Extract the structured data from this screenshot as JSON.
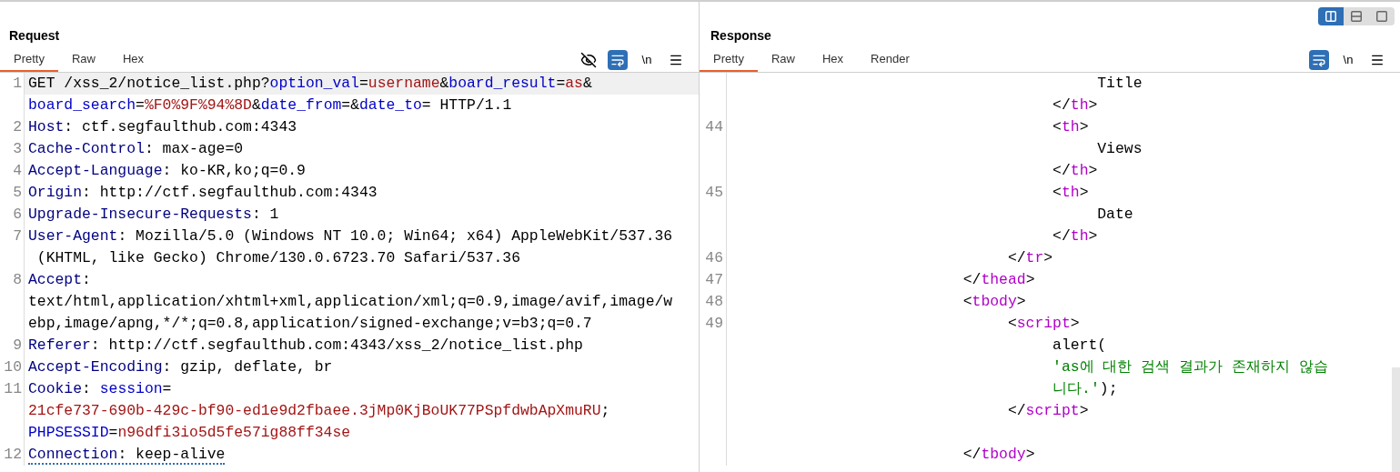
{
  "layout_options": [
    {
      "kind": "columns",
      "selected": true
    },
    {
      "kind": "rows",
      "selected": false
    },
    {
      "kind": "single",
      "selected": false
    }
  ],
  "request": {
    "title": "Request",
    "tabs": [
      {
        "label": "Pretty",
        "selected": true
      },
      {
        "label": "Raw",
        "selected": false
      },
      {
        "label": "Hex",
        "selected": false
      }
    ],
    "toolbar": {
      "wrap_on": true,
      "newline_label": "\\n"
    },
    "lines": [
      {
        "number": "1",
        "highlighted": true,
        "underlined": false,
        "rows": [
          {
            "segments": [
              {
                "kind": "text",
                "text": "GET /xss_2/notice_list.php?"
              },
              {
                "kind": "param",
                "text": "option_val"
              },
              {
                "kind": "text",
                "text": "="
              },
              {
                "kind": "value",
                "text": "username"
              },
              {
                "kind": "text",
                "text": "&"
              },
              {
                "kind": "param",
                "text": "board_result"
              },
              {
                "kind": "text",
                "text": "="
              },
              {
                "kind": "value",
                "text": "as"
              },
              {
                "kind": "text",
                "text": "&"
              }
            ]
          },
          {
            "segments": [
              {
                "kind": "param",
                "text": "board_search"
              },
              {
                "kind": "text",
                "text": "="
              },
              {
                "kind": "value",
                "text": "%F0%9F%94%8D"
              },
              {
                "kind": "text",
                "text": "&"
              },
              {
                "kind": "param",
                "text": "date_from"
              },
              {
                "kind": "text",
                "text": "=&"
              },
              {
                "kind": "param",
                "text": "date_to"
              },
              {
                "kind": "text",
                "text": "= HTTP/1.1"
              }
            ]
          }
        ]
      },
      {
        "number": "2",
        "highlighted": false,
        "underlined": false,
        "rows": [
          {
            "segments": [
              {
                "kind": "key",
                "text": "Host"
              },
              {
                "kind": "text",
                "text": ": ctf.segfaulthub.com:4343"
              }
            ]
          }
        ]
      },
      {
        "number": "3",
        "highlighted": false,
        "underlined": false,
        "rows": [
          {
            "segments": [
              {
                "kind": "key",
                "text": "Cache-Control"
              },
              {
                "kind": "text",
                "text": ": max-age=0"
              }
            ]
          }
        ]
      },
      {
        "number": "4",
        "highlighted": false,
        "underlined": false,
        "rows": [
          {
            "segments": [
              {
                "kind": "key",
                "text": "Accept-Language"
              },
              {
                "kind": "text",
                "text": ": ko-KR,ko;q=0.9"
              }
            ]
          }
        ]
      },
      {
        "number": "5",
        "highlighted": false,
        "underlined": false,
        "rows": [
          {
            "segments": [
              {
                "kind": "key",
                "text": "Origin"
              },
              {
                "kind": "text",
                "text": ": http://ctf.segfaulthub.com:4343"
              }
            ]
          }
        ]
      },
      {
        "number": "6",
        "highlighted": false,
        "underlined": false,
        "rows": [
          {
            "segments": [
              {
                "kind": "key",
                "text": "Upgrade-Insecure-Requests"
              },
              {
                "kind": "text",
                "text": ": 1"
              }
            ]
          }
        ]
      },
      {
        "number": "7",
        "highlighted": false,
        "underlined": false,
        "rows": [
          {
            "segments": [
              {
                "kind": "key",
                "text": "User-Agent"
              },
              {
                "kind": "text",
                "text": ": Mozilla/5.0 (Windows NT 10.0; Win64; x64) AppleWebKit/537.36"
              }
            ]
          },
          {
            "segments": [
              {
                "kind": "text",
                "text": " (KHTML, like Gecko) Chrome/130.0.6723.70 Safari/537.36"
              }
            ]
          }
        ]
      },
      {
        "number": "8",
        "highlighted": false,
        "underlined": false,
        "rows": [
          {
            "segments": [
              {
                "kind": "key",
                "text": "Accept"
              },
              {
                "kind": "text",
                "text": ":"
              }
            ]
          },
          {
            "segments": [
              {
                "kind": "text",
                "text": "text/html,application/xhtml+xml,application/xml;q=0.9,image/avif,image/w"
              }
            ]
          },
          {
            "segments": [
              {
                "kind": "text",
                "text": "ebp,image/apng,*/*;q=0.8,application/signed-exchange;v=b3;q=0.7"
              }
            ]
          }
        ]
      },
      {
        "number": "9",
        "highlighted": false,
        "underlined": false,
        "rows": [
          {
            "segments": [
              {
                "kind": "key",
                "text": "Referer"
              },
              {
                "kind": "text",
                "text": ": http://ctf.segfaulthub.com:4343/xss_2/notice_list.php"
              }
            ]
          }
        ]
      },
      {
        "number": "10",
        "highlighted": false,
        "underlined": false,
        "rows": [
          {
            "segments": [
              {
                "kind": "key",
                "text": "Accept-Encoding"
              },
              {
                "kind": "text",
                "text": ": gzip, deflate, br"
              }
            ]
          }
        ]
      },
      {
        "number": "11",
        "highlighted": false,
        "underlined": false,
        "rows": [
          {
            "segments": [
              {
                "kind": "key",
                "text": "Cookie"
              },
              {
                "kind": "text",
                "text": ": "
              },
              {
                "kind": "param",
                "text": "session"
              },
              {
                "kind": "text",
                "text": "="
              }
            ]
          },
          {
            "segments": [
              {
                "kind": "value",
                "text": "21cfe737-690b-429c-bf90-ed1e9d2fbaee.3jMp0KjBoUK77PSpfdwbApXmuRU"
              },
              {
                "kind": "text",
                "text": ";"
              }
            ]
          },
          {
            "segments": [
              {
                "kind": "param",
                "text": "PHPSESSID"
              },
              {
                "kind": "text",
                "text": "="
              },
              {
                "kind": "value",
                "text": "n96dfi3io5d5fe57ig88ff34se"
              }
            ]
          }
        ]
      },
      {
        "number": "12",
        "highlighted": false,
        "underlined": true,
        "rows": [
          {
            "segments": [
              {
                "kind": "key",
                "text": "Connection"
              },
              {
                "kind": "text",
                "text": ": keep-alive"
              }
            ]
          }
        ]
      }
    ]
  },
  "response": {
    "title": "Response",
    "tabs": [
      {
        "label": "Pretty",
        "selected": true
      },
      {
        "label": "Raw",
        "selected": false
      },
      {
        "label": "Hex",
        "selected": false
      },
      {
        "label": "Render",
        "selected": false
      }
    ],
    "toolbar": {
      "wrap_on": true,
      "newline_label": "\\n"
    },
    "lines": [
      {
        "rows": [
          {
            "indent": "                                         ",
            "segments": [
              {
                "kind": "text",
                "text": "Title"
              }
            ]
          },
          {
            "indent": "                                    ",
            "segments": [
              {
                "kind": "punct",
                "text": "</"
              },
              {
                "kind": "tag",
                "text": "th"
              },
              {
                "kind": "punct",
                "text": ">"
              }
            ]
          }
        ]
      },
      {
        "number": "44",
        "rows": [
          {
            "indent": "                                    ",
            "segments": [
              {
                "kind": "punct",
                "text": "<"
              },
              {
                "kind": "tag",
                "text": "th"
              },
              {
                "kind": "punct",
                "text": ">"
              }
            ]
          },
          {
            "indent": "                                         ",
            "segments": [
              {
                "kind": "text",
                "text": "Views"
              }
            ]
          },
          {
            "indent": "                                    ",
            "segments": [
              {
                "kind": "punct",
                "text": "</"
              },
              {
                "kind": "tag",
                "text": "th"
              },
              {
                "kind": "punct",
                "text": ">"
              }
            ]
          }
        ]
      },
      {
        "number": "45",
        "rows": [
          {
            "indent": "                                    ",
            "segments": [
              {
                "kind": "punct",
                "text": "<"
              },
              {
                "kind": "tag",
                "text": "th"
              },
              {
                "kind": "punct",
                "text": ">"
              }
            ]
          },
          {
            "indent": "                                         ",
            "segments": [
              {
                "kind": "text",
                "text": "Date"
              }
            ]
          },
          {
            "indent": "                                    ",
            "segments": [
              {
                "kind": "punct",
                "text": "</"
              },
              {
                "kind": "tag",
                "text": "th"
              },
              {
                "kind": "punct",
                "text": ">"
              }
            ]
          }
        ]
      },
      {
        "number": "46",
        "rows": [
          {
            "indent": "                               ",
            "segments": [
              {
                "kind": "punct",
                "text": "</"
              },
              {
                "kind": "tag",
                "text": "tr"
              },
              {
                "kind": "punct",
                "text": ">"
              }
            ]
          }
        ]
      },
      {
        "number": "47",
        "rows": [
          {
            "indent": "                          ",
            "segments": [
              {
                "kind": "punct",
                "text": "</"
              },
              {
                "kind": "tag",
                "text": "thead"
              },
              {
                "kind": "punct",
                "text": ">"
              }
            ]
          }
        ]
      },
      {
        "number": "48",
        "rows": [
          {
            "indent": "                          ",
            "segments": [
              {
                "kind": "punct",
                "text": "<"
              },
              {
                "kind": "tag",
                "text": "tbody"
              },
              {
                "kind": "punct",
                "text": ">"
              }
            ]
          }
        ]
      },
      {
        "number": "49",
        "rows": [
          {
            "indent": "                               ",
            "segments": [
              {
                "kind": "punct",
                "text": "<"
              },
              {
                "kind": "tag",
                "text": "script"
              },
              {
                "kind": "punct",
                "text": ">"
              }
            ]
          },
          {
            "indent": "                                    ",
            "segments": [
              {
                "kind": "text",
                "text": "alert("
              }
            ]
          },
          {
            "indent": "                                    ",
            "segments": [
              {
                "kind": "string",
                "text": "'as에 대한 검색 결과가 존재하지 않습"
              }
            ]
          },
          {
            "indent": "                                    ",
            "segments": [
              {
                "kind": "string",
                "text": "니다.'"
              },
              {
                "kind": "text",
                "text": ");"
              }
            ]
          },
          {
            "indent": "                               ",
            "segments": [
              {
                "kind": "punct",
                "text": "</"
              },
              {
                "kind": "tag",
                "text": "script"
              },
              {
                "kind": "punct",
                "text": ">"
              }
            ]
          },
          {
            "indent": ""
          },
          {
            "indent": "                          ",
            "segments": [
              {
                "kind": "punct",
                "text": "</"
              },
              {
                "kind": "tag",
                "text": "tbody"
              },
              {
                "kind": "punct",
                "text": ">"
              }
            ]
          }
        ]
      }
    ]
  }
}
